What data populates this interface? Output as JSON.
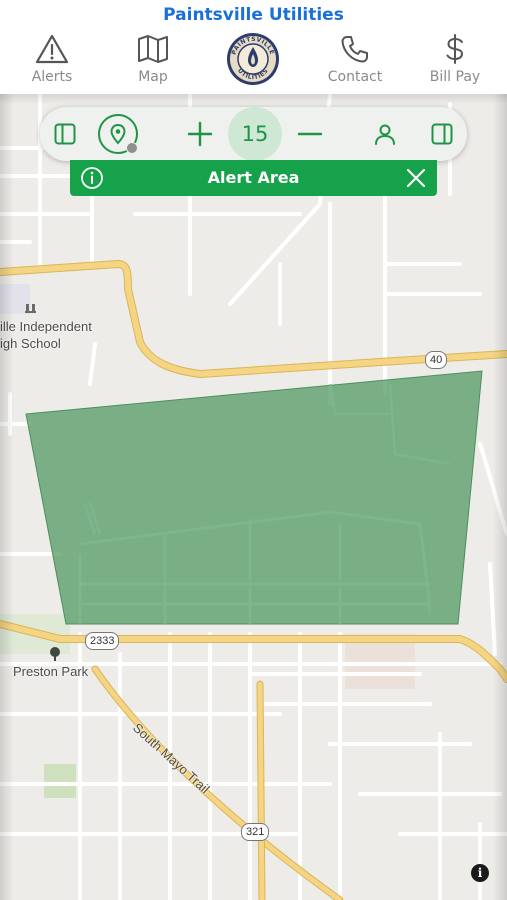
{
  "app": {
    "title": "Paintsville Utilities"
  },
  "nav": {
    "items": [
      {
        "label": "Alerts",
        "icon": "alert-triangle-icon"
      },
      {
        "label": "Map",
        "icon": "map-icon"
      },
      {
        "label": "Contact",
        "icon": "phone-icon"
      },
      {
        "label": "Bill Pay",
        "icon": "dollar-icon"
      }
    ],
    "logo": {
      "text": "PAINTSVILLE UTILITIES",
      "icon": "city-seal-logo"
    }
  },
  "toolbar": {
    "zoom_level": "15",
    "icons": [
      "sidebar-left-icon",
      "location-pin-icon",
      "zoom-in-icon",
      "zoom-out-icon",
      "user-icon",
      "sidebar-right-icon"
    ]
  },
  "alert": {
    "title": "Alert Area",
    "icons": [
      "info-icon",
      "close-icon"
    ]
  },
  "map": {
    "places": {
      "school_line1": "ille Independent",
      "school_line2": "igh School",
      "park": "Preston Park"
    },
    "roads": {
      "south_mayo": "South Mayo Trail"
    },
    "shields": {
      "route_40": "40",
      "route_2333": "2333",
      "route_321": "321"
    },
    "attribution_label": "i"
  },
  "colors": {
    "brand_blue": "#1a6fd9",
    "accent_green": "#16a24a",
    "alert_polygon": "#5a9e6a",
    "primary_road": "#f5d483"
  }
}
